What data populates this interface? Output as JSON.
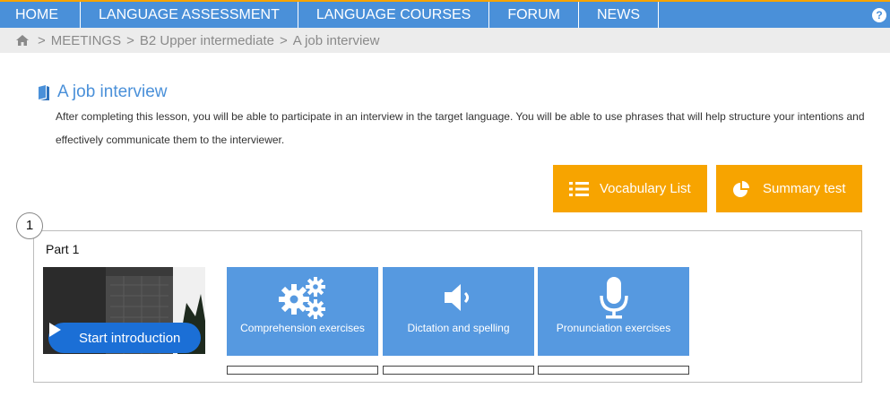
{
  "nav": {
    "items": [
      {
        "label": "Home"
      },
      {
        "label": "Language assessment"
      },
      {
        "label": "Language courses"
      },
      {
        "label": "Forum"
      },
      {
        "label": "News"
      }
    ],
    "help_label": "?"
  },
  "breadcrumb": {
    "separator": ">",
    "items": [
      "MEETINGS",
      "B2 Upper intermediate",
      "A job interview"
    ]
  },
  "lesson": {
    "title": "A job interview",
    "description": "After completing this lesson, you will be able to participate in an interview in the target language. You will be able to use phrases that will help structure your intentions and effectively communicate them to the interviewer."
  },
  "actions": {
    "vocabulary_label": "Vocabulary List",
    "summary_label": "Summary test"
  },
  "part": {
    "number": "1",
    "label": "Part 1",
    "intro_label": "Start introduction",
    "exercises": [
      {
        "label": "Comprehension exercises",
        "icon": "gears-icon",
        "progress": 0
      },
      {
        "label": "Dictation and spelling",
        "icon": "speaker-icon",
        "progress": 0
      },
      {
        "label": "Pronunciation exercises",
        "icon": "microphone-icon",
        "progress": 0
      }
    ]
  },
  "colors": {
    "nav_blue": "#4a90d9",
    "accent_orange": "#f7a400",
    "tile_blue": "#5699e0",
    "play_blue": "#1b6fd6"
  }
}
